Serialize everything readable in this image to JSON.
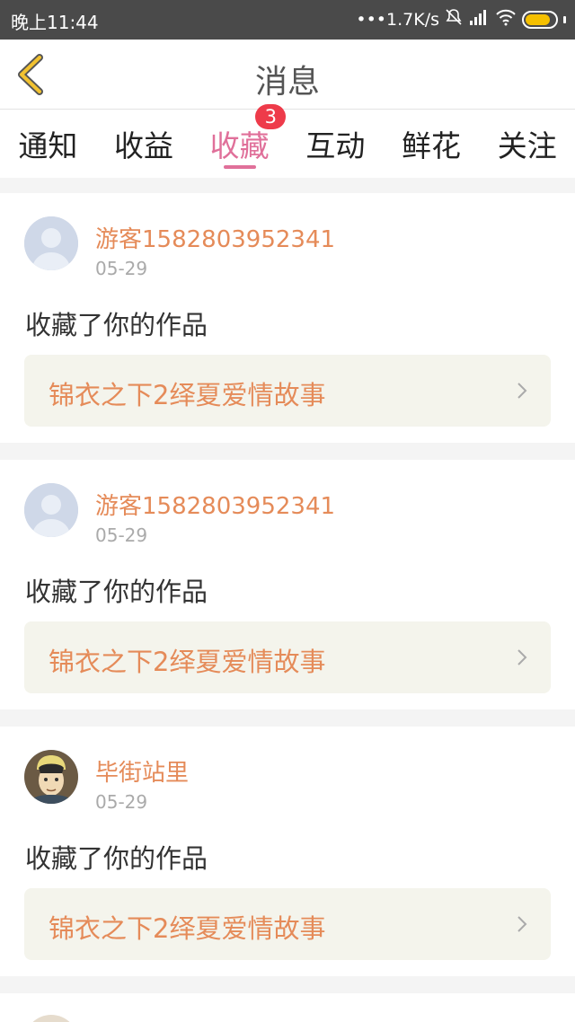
{
  "status_bar": {
    "time": "晚上11:44",
    "speed": "•••1.7K/s",
    "battery_level": 0.85
  },
  "header": {
    "title": "消息",
    "back_icon": "chevron-left-icon"
  },
  "tabs": [
    {
      "label": "通知"
    },
    {
      "label": "收益"
    },
    {
      "label": "收藏",
      "active": true,
      "badge": "3"
    },
    {
      "label": "互动"
    },
    {
      "label": "鲜花"
    },
    {
      "label": "关注"
    }
  ],
  "messages": [
    {
      "user": "游客1582803952341",
      "date": "05-29",
      "text": "收藏了你的作品",
      "work_title": "锦衣之下2绎夏爱情故事",
      "avatar": "default-avatar"
    },
    {
      "user": "游客1582803952341",
      "date": "05-29",
      "text": "收藏了你的作品",
      "work_title": "锦衣之下2绎夏爱情故事",
      "avatar": "default-avatar"
    },
    {
      "user": "毕街站里",
      "date": "05-29",
      "text": "收藏了你的作品",
      "work_title": "锦衣之下2绎夏爱情故事",
      "avatar": "cartoon-portrait-avatar"
    }
  ],
  "colors": {
    "accent_pink": "#e0709a",
    "username_orange": "#e58b59",
    "badge_red": "#ee3b4a",
    "back_yellow": "#f2c230"
  }
}
